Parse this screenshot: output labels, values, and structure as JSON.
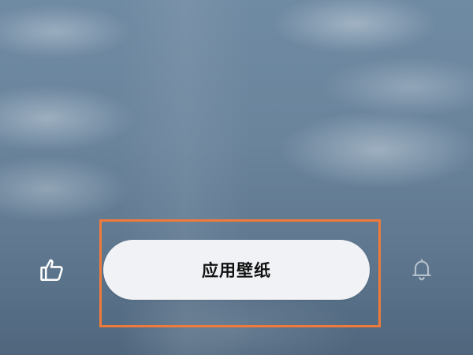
{
  "apply_button": {
    "label": "应用壁纸"
  },
  "icons": {
    "left": "thumbs-up-icon",
    "right": "bell-icon"
  },
  "colors": {
    "highlight": "#f07a3c",
    "button_bg": "#f1f2f5"
  }
}
